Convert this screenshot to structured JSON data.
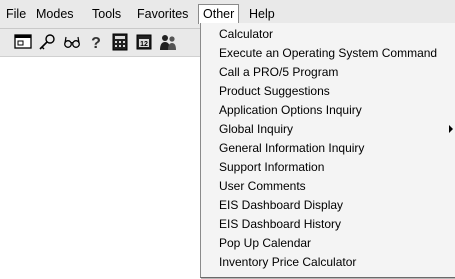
{
  "menubar": {
    "items": [
      {
        "label": "File"
      },
      {
        "label": "Modes"
      },
      {
        "label": "Tools"
      },
      {
        "label": "Favorites"
      },
      {
        "label": "Other"
      },
      {
        "label": "Help"
      }
    ],
    "open_menu": "Other"
  },
  "toolbar": {
    "buttons": [
      {
        "icon": "window-icon"
      },
      {
        "icon": "key-icon"
      },
      {
        "icon": "glasses-icon"
      },
      {
        "icon": "help-icon"
      },
      {
        "icon": "calculator-icon"
      },
      {
        "icon": "calendar-icon"
      },
      {
        "icon": "people-icon"
      }
    ]
  },
  "other_menu": {
    "items": [
      {
        "label": "Calculator"
      },
      {
        "label": "Execute an Operating System Command"
      },
      {
        "label": "Call a PRO/5 Program"
      },
      {
        "label": "Product Suggestions"
      },
      {
        "label": "Application Options Inquiry"
      },
      {
        "label": "Global Inquiry",
        "has_submenu": true
      },
      {
        "label": "General Information Inquiry"
      },
      {
        "label": "Support Information"
      },
      {
        "label": "User Comments"
      },
      {
        "label": "EIS Dashboard Display"
      },
      {
        "label": "EIS Dashboard History"
      },
      {
        "label": "Pop Up Calendar"
      },
      {
        "label": "Inventory Price Calculator"
      }
    ]
  }
}
